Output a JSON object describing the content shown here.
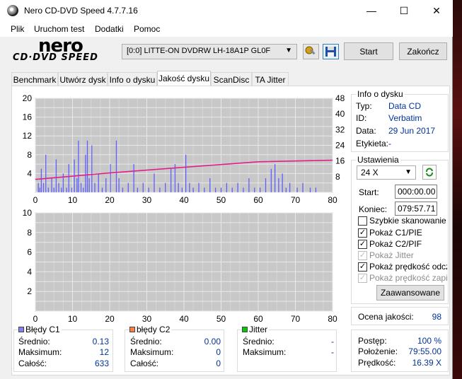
{
  "window": {
    "title": "Nero CD-DVD Speed 4.7.7.16",
    "minimize": "—",
    "maximize": "☐",
    "close": "✕"
  },
  "menu": [
    "Plik",
    "Uruchom test",
    "Dodatki",
    "Pomoc"
  ],
  "logo": {
    "line1": "nero",
    "line2": "CD·DVD SPEED"
  },
  "toolbar": {
    "drive": "[0:0]   LITTE-ON DVDRW LH-18A1P GL0F",
    "start_label": "Start",
    "quit_label": "Zakończ",
    "options_icon": "wrench-icon",
    "save_icon": "floppy-disk-icon"
  },
  "tabs": [
    "Benchmark",
    "Utwórz dysk",
    "Info o dysku",
    "Jakość dysku",
    "ScanDisc",
    "TA Jitter"
  ],
  "active_tab": "Jakość dysku",
  "disc_info": {
    "title": "Info o dysku",
    "rows": [
      {
        "label": "Typ:",
        "value": "Data CD"
      },
      {
        "label": "ID:",
        "value": "Verbatim"
      },
      {
        "label": "Data:",
        "value": "29 Jun 2017"
      },
      {
        "label": "Etykieta:",
        "value": "-"
      }
    ]
  },
  "settings": {
    "title": "Ustawienia",
    "speed": "24 X",
    "start_label": "Start:",
    "start_value": "000:00.00",
    "end_label": "Koniec:",
    "end_value": "079:57.71",
    "checkboxes": [
      {
        "label": "Szybkie skanowanie",
        "checked": false,
        "disabled": false
      },
      {
        "label": "Pokaż C1/PIE",
        "checked": true,
        "disabled": false
      },
      {
        "label": "Pokaż C2/PIF",
        "checked": true,
        "disabled": false
      },
      {
        "label": "Pokaż Jitter",
        "checked": true,
        "disabled": true
      },
      {
        "label": "Pokaż prędkość odczytu",
        "checked": true,
        "disabled": false
      },
      {
        "label": "Pokaż prędkość zapisu",
        "checked": true,
        "disabled": true
      }
    ],
    "advanced_label": "Zaawansowane"
  },
  "quality": {
    "label": "Ocena jakości:",
    "value": "98"
  },
  "progress": {
    "rows": [
      {
        "label": "Postęp:",
        "value": "100 %"
      },
      {
        "label": "Położenie:",
        "value": "79:55.00"
      },
      {
        "label": "Prędkość:",
        "value": "16.39 X"
      }
    ]
  },
  "stats": [
    {
      "title": "Błędy C1",
      "color": "#8080ff",
      "rows": [
        {
          "label": "Średnio:",
          "value": "0.13"
        },
        {
          "label": "Maksimum:",
          "value": "12"
        },
        {
          "label": "Całość:",
          "value": "633"
        }
      ]
    },
    {
      "title": "błędy C2",
      "color": "#ff8040",
      "rows": [
        {
          "label": "Średnio:",
          "value": "0.00"
        },
        {
          "label": "Maksimum:",
          "value": "0"
        },
        {
          "label": "Całość:",
          "value": "0"
        }
      ]
    },
    {
      "title": "Jitter",
      "color": "#00cc00",
      "rows": [
        {
          "label": "Średnio:",
          "value": "-"
        },
        {
          "label": "Maksimum:",
          "value": "-"
        }
      ]
    }
  ],
  "chart_data": [
    {
      "type": "bar",
      "name_hint": "c1",
      "x_ticks": [
        0,
        10,
        20,
        30,
        40,
        50,
        60,
        70,
        80
      ],
      "y_ticks_left": [
        4,
        8,
        12,
        16,
        20
      ],
      "y_ticks_right": [
        8,
        16,
        24,
        32,
        40,
        48
      ],
      "xlim": [
        0,
        80
      ],
      "ylim": [
        0,
        20
      ],
      "ylim_right": [
        0,
        48
      ],
      "grid": true,
      "bar_color": "#6060ff",
      "speed_color": "#e0208a",
      "bars": [
        [
          0.8,
          2
        ],
        [
          1.2,
          1
        ],
        [
          1.6,
          5
        ],
        [
          2.2,
          2
        ],
        [
          2.8,
          8
        ],
        [
          3.5,
          1
        ],
        [
          4.4,
          3
        ],
        [
          5.0,
          1
        ],
        [
          5.6,
          7
        ],
        [
          6.3,
          2
        ],
        [
          7.0,
          1
        ],
        [
          7.5,
          4
        ],
        [
          8.4,
          1
        ],
        [
          9.0,
          6
        ],
        [
          9.8,
          1
        ],
        [
          10.5,
          7
        ],
        [
          11.2,
          3
        ],
        [
          11.6,
          11
        ],
        [
          12.3,
          2
        ],
        [
          12.9,
          1
        ],
        [
          13.5,
          8
        ],
        [
          14.0,
          11
        ],
        [
          14.5,
          3
        ],
        [
          15.2,
          10
        ],
        [
          16.0,
          2
        ],
        [
          17.0,
          4
        ],
        [
          18.0,
          1
        ],
        [
          19.0,
          3
        ],
        [
          20.2,
          6
        ],
        [
          21.8,
          11
        ],
        [
          22.5,
          3
        ],
        [
          23.5,
          1
        ],
        [
          25.0,
          2
        ],
        [
          26.5,
          6
        ],
        [
          27.5,
          1
        ],
        [
          29.0,
          2
        ],
        [
          30.5,
          1
        ],
        [
          32.0,
          4
        ],
        [
          33.5,
          1
        ],
        [
          35.0,
          2
        ],
        [
          36.5,
          5
        ],
        [
          37.6,
          6
        ],
        [
          38.5,
          2
        ],
        [
          39.5,
          1
        ],
        [
          40.5,
          8
        ],
        [
          41.5,
          2
        ],
        [
          42.5,
          1
        ],
        [
          44.0,
          2
        ],
        [
          45.5,
          1
        ],
        [
          47.0,
          3
        ],
        [
          48.5,
          1
        ],
        [
          50.0,
          1
        ],
        [
          51.5,
          2
        ],
        [
          53.0,
          1
        ],
        [
          54.5,
          2
        ],
        [
          56.0,
          1
        ],
        [
          57.5,
          3
        ],
        [
          59.0,
          1
        ],
        [
          60.5,
          1
        ],
        [
          62.0,
          3
        ],
        [
          63.5,
          5
        ],
        [
          64.5,
          6
        ],
        [
          65.5,
          3
        ],
        [
          66.5,
          4
        ],
        [
          67.5,
          1
        ],
        [
          68.5,
          2
        ],
        [
          70.5,
          1
        ],
        [
          72.0,
          2
        ],
        [
          74.0,
          1
        ],
        [
          75.5,
          1
        ]
      ],
      "speed": [
        [
          0,
          6.6
        ],
        [
          20,
          9.9
        ],
        [
          40,
          12.8
        ],
        [
          60,
          15.6
        ],
        [
          80,
          16.4
        ]
      ]
    },
    {
      "type": "bar",
      "name_hint": "c2",
      "x_ticks": [
        0,
        10,
        20,
        30,
        40,
        50,
        60,
        70,
        80
      ],
      "y_ticks_left": [
        2,
        4,
        6,
        8,
        10
      ],
      "xlim": [
        0,
        80
      ],
      "ylim": [
        0,
        10
      ],
      "grid": true,
      "bars": []
    }
  ]
}
